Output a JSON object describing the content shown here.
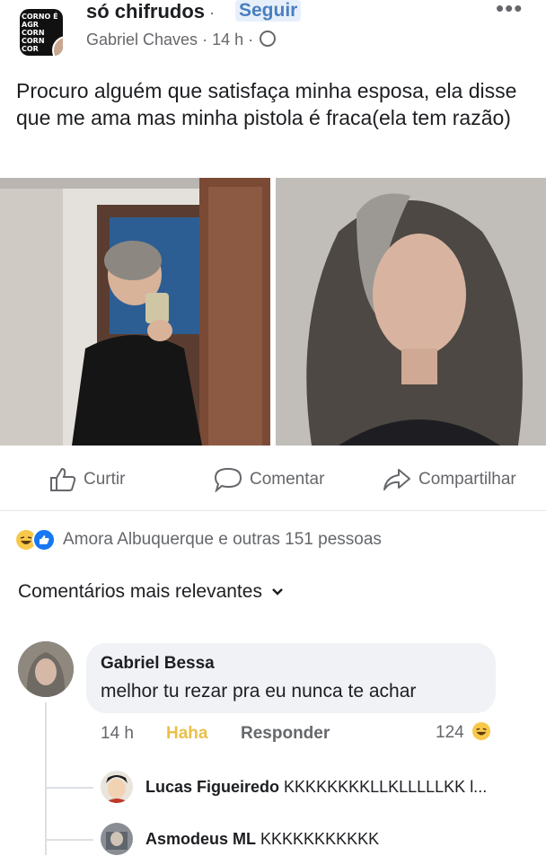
{
  "header": {
    "group_avatar_text": "CORNO É AGR CORN CORN COR",
    "group_name": "só chifrudos",
    "separator": "·",
    "follow_label": "Seguir",
    "more_icon": "more-horizontal-icon",
    "author": "Gabriel Chaves",
    "time": "14 h",
    "privacy_icon": "globe-icon"
  },
  "post": {
    "text": "Procuro alguém que satisfaça minha esposa, ela disse que me ama mas minha pistola é fraca(ela tem razão)"
  },
  "actions": {
    "like_label": "Curtir",
    "comment_label": "Comentar",
    "share_label": "Compartilhar"
  },
  "reactions": {
    "summary": "Amora Albuquerque e outras 151 pessoas"
  },
  "comments_filter": {
    "label": "Comentários mais relevantes"
  },
  "comment": {
    "author": "Gabriel Bessa",
    "text": "melhor tu rezar pra eu nunca te achar",
    "time": "14 h",
    "reaction_label": "Haha",
    "reply_label": "Responder",
    "reaction_count": "124"
  },
  "replies": [
    {
      "author": "Lucas Figueiredo",
      "text": "KKKKKKKKLLKLLLLLKK l..."
    },
    {
      "author": "Asmodeus ML",
      "text": "KKKKKKKKKKK"
    }
  ],
  "colors": {
    "accent": "#4a7fc1",
    "muted_text": "#65676b",
    "bubble": "#f0f2f5",
    "haha": "#e8c04a"
  }
}
